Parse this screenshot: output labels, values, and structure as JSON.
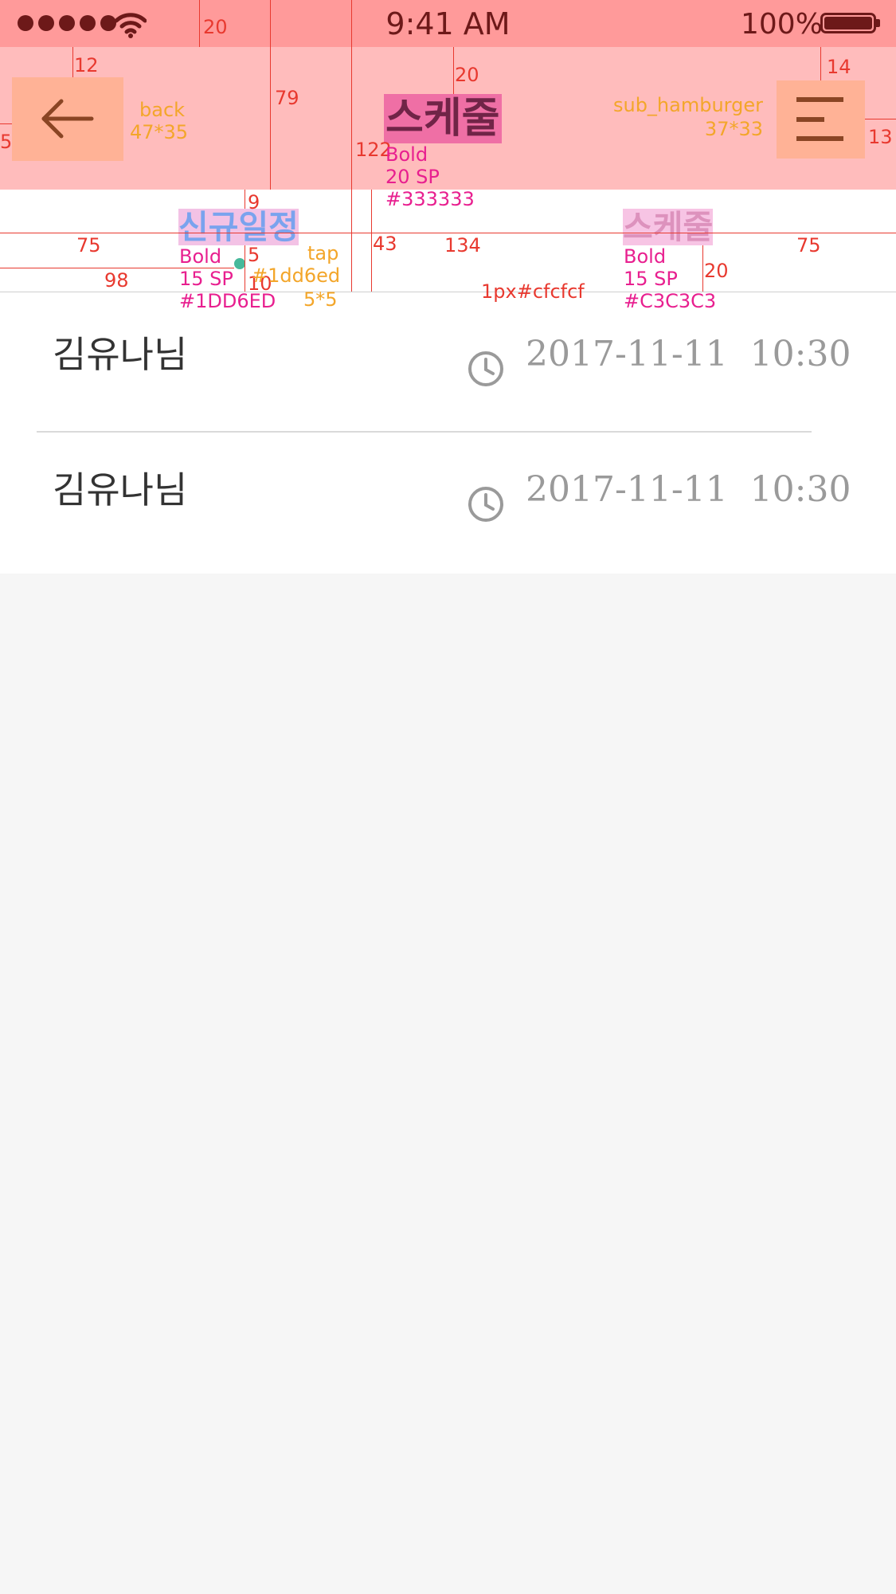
{
  "status_bar": {
    "time": "9:41 AM",
    "battery": "100%",
    "icons": [
      "signal-dots",
      "wifi-icon",
      "battery-icon"
    ]
  },
  "header": {
    "title": "스케줄",
    "back_icon": "arrow-left-icon",
    "menu_icon": "hamburger-icon"
  },
  "tabs": [
    {
      "label": "신규일정",
      "active": true,
      "color": "#1DD6ED"
    },
    {
      "label": "스케줄",
      "active": false,
      "color": "#C3C3C3"
    }
  ],
  "list": [
    {
      "name": "김유나님",
      "icon": "clock-icon",
      "time": "2017-11-11  10:30"
    },
    {
      "name": "김유나님",
      "icon": "clock-icon",
      "time": "2017-11-11  10:30"
    }
  ],
  "annotations": {
    "status_height": "20",
    "back_top": "12",
    "back_left": "5",
    "back_name": "back",
    "back_size": "47*35",
    "header_height": "79",
    "title_top": "20",
    "title_gap": "122",
    "title_spec": [
      "Bold",
      "20 SP",
      "#333333"
    ],
    "hamburger_name": "sub_hamburger",
    "hamburger_size": "37*33",
    "hamburger_top": "14",
    "hamburger_right": "13",
    "tab_top_gap": "9",
    "tab_left": "75",
    "tab_right": "75",
    "tab_mid": "134",
    "tab_height": "43",
    "tab_text_gap": "20",
    "dot_left": "98",
    "dot_top": "5",
    "dot_bottom": "10",
    "tap_name": "tap",
    "tap_color": "#1dd6ed",
    "tap_size": "5*5",
    "tab_active_spec": [
      "Bold",
      "15 SP",
      "#1DD6ED"
    ],
    "tab_inactive_spec": [
      "Bold",
      "15 SP",
      "#C3C3C3"
    ],
    "divider_spec": "1px#cfcfcf"
  }
}
